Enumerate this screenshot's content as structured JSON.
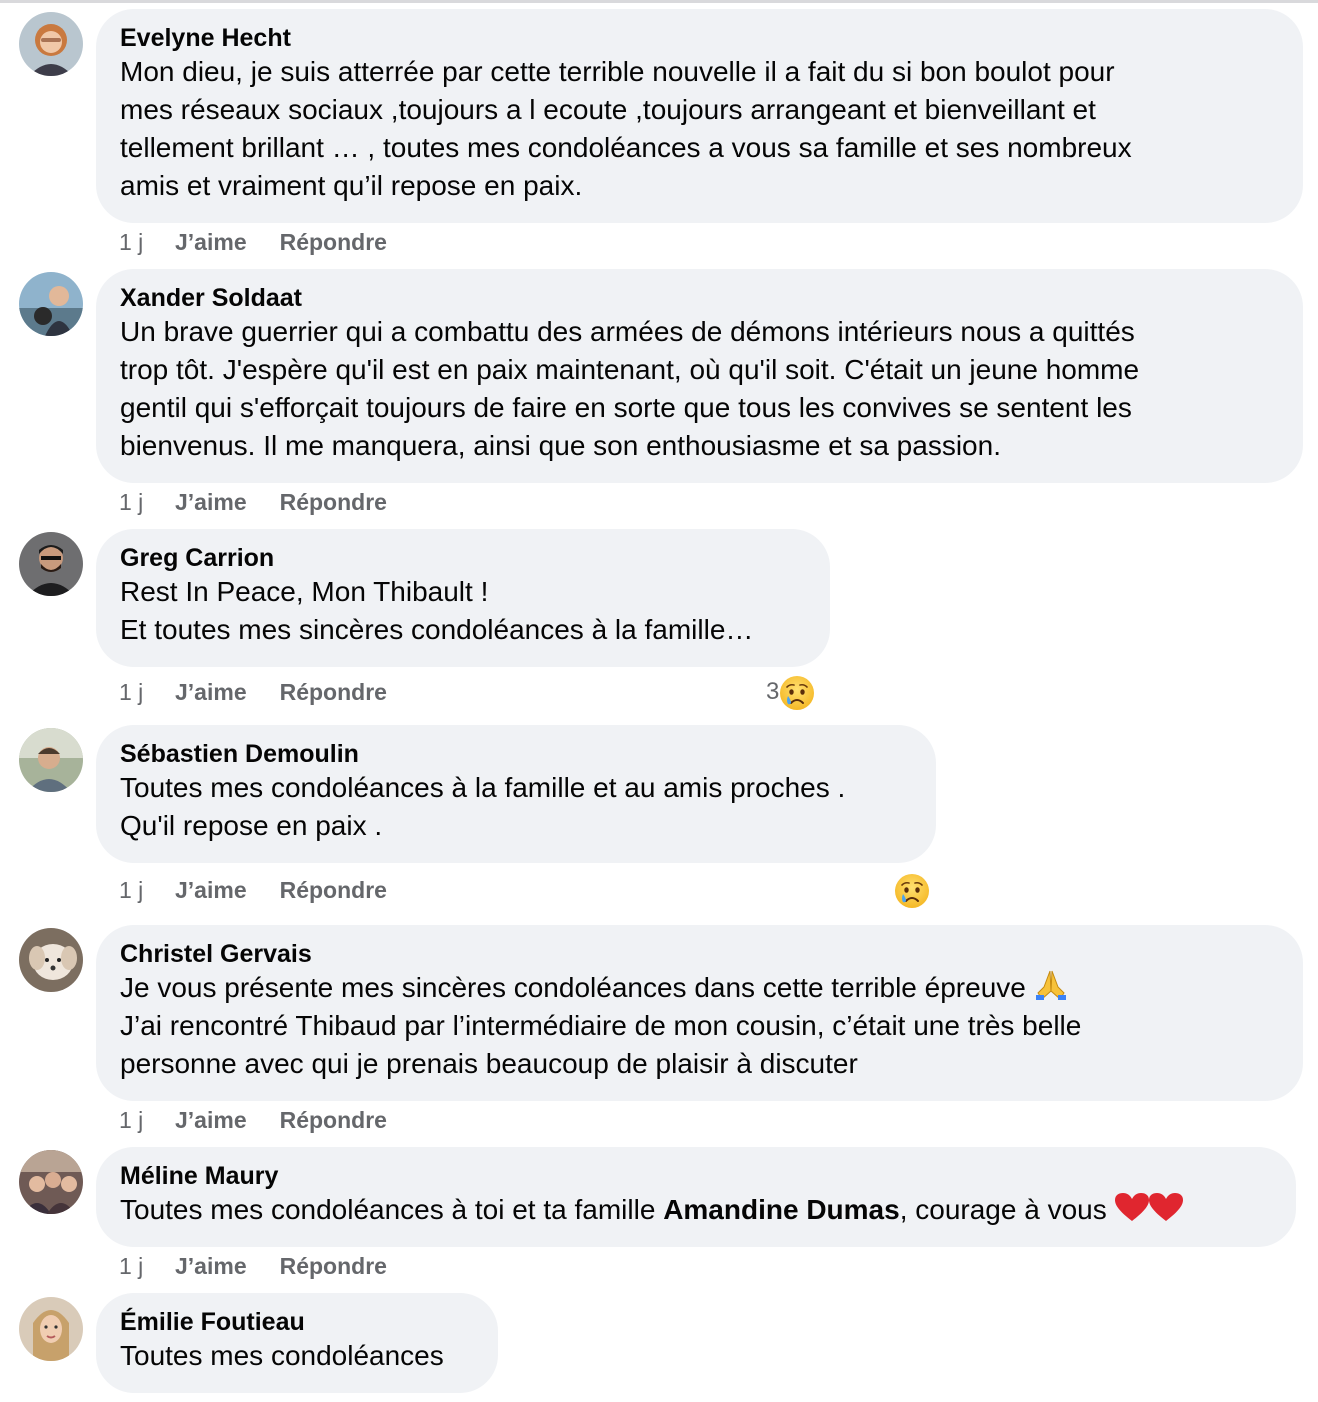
{
  "comments": [
    {
      "author": "Evelyne Hecht",
      "text": "Mon dieu, je suis atterrée par cette terrible nouvelle il a fait du si bon boulot pour\nmes réseaux sociaux ,toujours a l ecoute ,toujours arrangeant et bienveillant et\ntellement brillant … , toutes mes condoléances a vous sa famille et ses nombreux\namis et vraiment qu’il repose en paix.",
      "time": "1 j",
      "like": "J’aime",
      "reply": "Répondre"
    },
    {
      "author": "Xander Soldaat",
      "text": "Un brave guerrier qui a combattu des armées de démons intérieurs nous a quittés\ntrop tôt. J'espère qu'il est en paix maintenant, où qu'il soit. C'était un jeune homme\ngentil qui s'efforçait toujours de faire en sorte que tous les convives se sentent les\nbienvenus. Il me manquera, ainsi que son enthousiasme et sa passion.",
      "time": "1 j",
      "like": "J’aime",
      "reply": "Répondre"
    },
    {
      "author": "Greg Carrion",
      "text": "Rest In Peace, Mon Thibault !\nEt toutes mes sincères condoléances à la famille…",
      "time": "1 j",
      "like": "J’aime",
      "reply": "Répondre",
      "reaction_count": "3",
      "reaction_icon": "sad-face-icon"
    },
    {
      "author": "Sébastien Demoulin",
      "text": "Toutes mes condoléances à la famille et au amis proches .\nQu'il repose en paix .",
      "time": "1 j",
      "like": "J’aime",
      "reply": "Répondre",
      "reaction_icon": "sad-face-icon"
    },
    {
      "author": "Christel Gervais",
      "text_line1": "Je vous présente mes sincères condoléances dans cette terrible épreuve",
      "emoji_icon": "praying-hands-icon",
      "text_rest": "J’ai rencontré Thibaud par l’intermédiaire de mon cousin, c’était une très belle\npersonne avec qui je prenais beaucoup de plaisir à discuter",
      "time": "1 j",
      "like": "J’aime",
      "reply": "Répondre"
    },
    {
      "author": "Méline Maury",
      "text_before": "Toutes mes condoléances à toi et ta famille ",
      "mention": "Amandine Dumas",
      "text_after": ", courage à vous ",
      "emoji_icon": "red-heart-icon",
      "time": "1 j",
      "like": "J’aime",
      "reply": "Répondre"
    },
    {
      "author": "Émilie Foutieau",
      "text": "Toutes mes condoléances"
    }
  ],
  "colors": {
    "bubble": "#f0f2f5",
    "meta": "#65676b",
    "text": "#050505"
  }
}
